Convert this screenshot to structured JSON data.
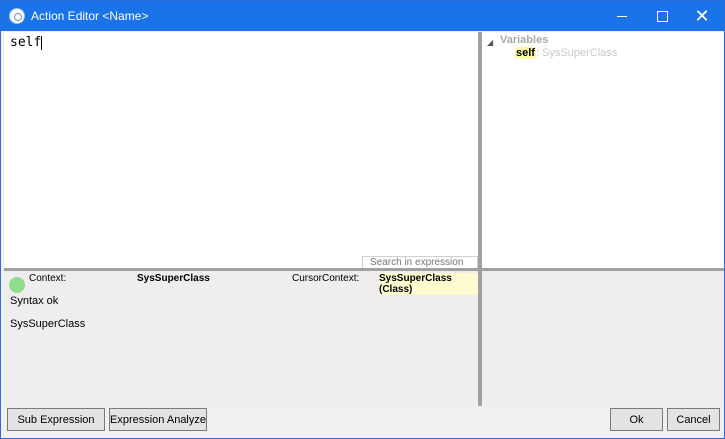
{
  "window": {
    "title": "Action Editor <Name>",
    "minimize_glyph": "",
    "maximize_glyph": "",
    "close_glyph": "✕"
  },
  "editor": {
    "text": "self",
    "search_placeholder": "Search in expression"
  },
  "variables": {
    "root_label": "Variables",
    "items": [
      {
        "name": "self",
        "type": ": SysSuperClass"
      }
    ]
  },
  "info": {
    "context_label": "Context:",
    "context_value": "SysSuperClass",
    "cursor_context_label": "CursorContext:",
    "cursor_context_value": "SysSuperClass (Class)",
    "syntax_message": "Syntax ok",
    "type_message": "SysSuperClass",
    "status_color": "#8fdc8f"
  },
  "buttons": {
    "sub_expression": "Sub Expression",
    "expression_analyze": "Expression Analyze",
    "ok": "Ok",
    "cancel": "Cancel"
  },
  "colors": {
    "titlebar": "#1a73e8",
    "highlight": "#fff9a8"
  }
}
